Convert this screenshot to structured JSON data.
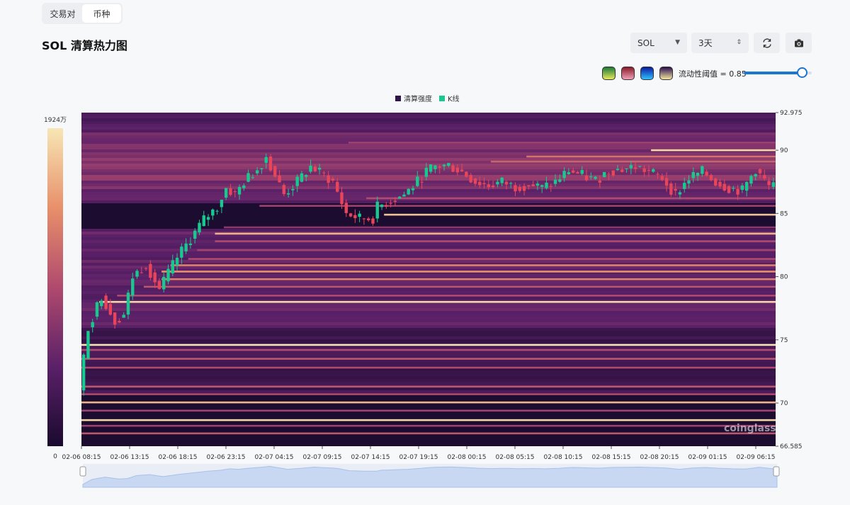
{
  "tabs": [
    {
      "label": "交易对",
      "active": false
    },
    {
      "label": "币种",
      "active": true
    }
  ],
  "page_title": "SOL 清算热力图",
  "controls": {
    "symbol": "SOL",
    "range": "3天",
    "icons": [
      "refresh-icon",
      "camera-icon"
    ],
    "palettes": [
      {
        "name": "green-yellow",
        "colors": [
          "#1a7a3a",
          "#e8e85a"
        ]
      },
      {
        "name": "red-pink",
        "colors": [
          "#8a1a2a",
          "#f0a0b8"
        ]
      },
      {
        "name": "blue",
        "colors": [
          "#0a1aa0",
          "#30c0ff"
        ]
      },
      {
        "name": "purple-yellow",
        "colors": [
          "#2a1050",
          "#f5e6a0"
        ]
      }
    ],
    "threshold_label": "流动性阈值 = 0.85",
    "threshold_value": 0.85
  },
  "chart_data": {
    "type": "heatmap",
    "legend": [
      {
        "name": "清算强度",
        "color": "#2d1548"
      },
      {
        "name": "K线",
        "color": "#18c98f"
      }
    ],
    "colorscale": {
      "max_label": "1924万",
      "min_label": "0",
      "colors": [
        "#1a0a2e",
        "#5a2068",
        "#b04a6e",
        "#e8906a",
        "#f7e6b5"
      ]
    },
    "y_axis": {
      "min": 66.585,
      "max": 92.975,
      "ticks": [
        92.975,
        90,
        85,
        80,
        75,
        70,
        66.585
      ]
    },
    "x_axis": {
      "ticks": [
        "02-06 08:15",
        "02-06 13:15",
        "02-06 18:15",
        "02-06 23:15",
        "02-07 04:15",
        "02-07 09:15",
        "02-07 14:15",
        "02-07 19:15",
        "02-08 00:15",
        "02-08 05:15",
        "02-08 10:15",
        "02-08 15:15",
        "02-08 20:15",
        "02-09 01:15",
        "02-09 06:15"
      ]
    },
    "price_path": [
      [
        0,
        71.0
      ],
      [
        2,
        76.0
      ],
      [
        5,
        78.5
      ],
      [
        8,
        76.5
      ],
      [
        10,
        77.0
      ],
      [
        12,
        80.0
      ],
      [
        15,
        81.0
      ],
      [
        18,
        79.0
      ],
      [
        22,
        81.5
      ],
      [
        26,
        83.5
      ],
      [
        28,
        84.5
      ],
      [
        31,
        85.5
      ],
      [
        33,
        87.0
      ],
      [
        35,
        86.5
      ],
      [
        37,
        87.5
      ],
      [
        40,
        88.5
      ],
      [
        42,
        89.5
      ],
      [
        44,
        88.0
      ],
      [
        46,
        86.5
      ],
      [
        49,
        87.5
      ],
      [
        52,
        88.7
      ],
      [
        55,
        88.0
      ],
      [
        57,
        87.5
      ],
      [
        60,
        85.0
      ],
      [
        63,
        84.6
      ],
      [
        66,
        84.6
      ],
      [
        67,
        85.5
      ],
      [
        70,
        86.0
      ],
      [
        73,
        86.5
      ],
      [
        76,
        87.5
      ],
      [
        78,
        88.3
      ],
      [
        80,
        88.7
      ],
      [
        83,
        88.8
      ],
      [
        86,
        88.3
      ],
      [
        89,
        87.5
      ],
      [
        92,
        87.2
      ],
      [
        95,
        87.5
      ],
      [
        98,
        87.1
      ],
      [
        101,
        87.3
      ],
      [
        104,
        87.0
      ],
      [
        107,
        87.5
      ],
      [
        110,
        88.4
      ],
      [
        113,
        88.0
      ],
      [
        116,
        87.6
      ],
      [
        119,
        88.4
      ],
      [
        122,
        88.5
      ],
      [
        125,
        88.7
      ],
      [
        128,
        88.3
      ],
      [
        131,
        87.8
      ],
      [
        134,
        86.5
      ],
      [
        137,
        87.8
      ],
      [
        140,
        88.3
      ],
      [
        143,
        87.5
      ],
      [
        146,
        87.0
      ],
      [
        149,
        86.8
      ],
      [
        152,
        88.5
      ],
      [
        155,
        87.1
      ]
    ],
    "liquidation_bands": [
      {
        "price": 74.6,
        "intensity": 1.0,
        "start": 0
      },
      {
        "price": 74.2,
        "intensity": 0.5,
        "start": 0
      },
      {
        "price": 73.5,
        "intensity": 0.55,
        "start": 0
      },
      {
        "price": 72.8,
        "intensity": 0.5,
        "start": 0
      },
      {
        "price": 71.3,
        "intensity": 0.55,
        "start": 0
      },
      {
        "price": 70.7,
        "intensity": 0.5,
        "start": 0
      },
      {
        "price": 70.05,
        "intensity": 0.85,
        "start": 0
      },
      {
        "price": 69.4,
        "intensity": 0.45,
        "start": 0
      },
      {
        "price": 68.65,
        "intensity": 0.95,
        "start": 0
      },
      {
        "price": 68.2,
        "intensity": 0.45,
        "start": 0
      },
      {
        "price": 67.6,
        "intensity": 0.55,
        "start": 0
      },
      {
        "price": 78.0,
        "intensity": 0.95,
        "start": 4
      },
      {
        "price": 78.5,
        "intensity": 0.5,
        "start": 8
      },
      {
        "price": 79.2,
        "intensity": 0.55,
        "start": 14
      },
      {
        "price": 79.8,
        "intensity": 0.7,
        "start": 18
      },
      {
        "price": 80.4,
        "intensity": 0.75,
        "start": 18
      },
      {
        "price": 80.9,
        "intensity": 0.7,
        "start": 20
      },
      {
        "price": 81.4,
        "intensity": 0.5,
        "start": 24
      },
      {
        "price": 82.1,
        "intensity": 0.45,
        "start": 26
      },
      {
        "price": 82.8,
        "intensity": 0.5,
        "start": 30
      },
      {
        "price": 83.4,
        "intensity": 0.85,
        "start": 30
      },
      {
        "price": 83.9,
        "intensity": 0.4,
        "start": 32
      },
      {
        "price": 84.9,
        "intensity": 0.9,
        "start": 68
      },
      {
        "price": 85.6,
        "intensity": 0.45,
        "start": 40
      },
      {
        "price": 86.2,
        "intensity": 0.5,
        "start": 64
      },
      {
        "price": 89.1,
        "intensity": 0.6,
        "start": 92
      },
      {
        "price": 89.5,
        "intensity": 0.65,
        "start": 100
      },
      {
        "price": 90.0,
        "intensity": 0.95,
        "start": 128
      },
      {
        "price": 90.6,
        "intensity": 0.45,
        "start": 60
      },
      {
        "price": 91.3,
        "intensity": 0.35,
        "start": 44
      }
    ],
    "watermark": "coinglass"
  }
}
